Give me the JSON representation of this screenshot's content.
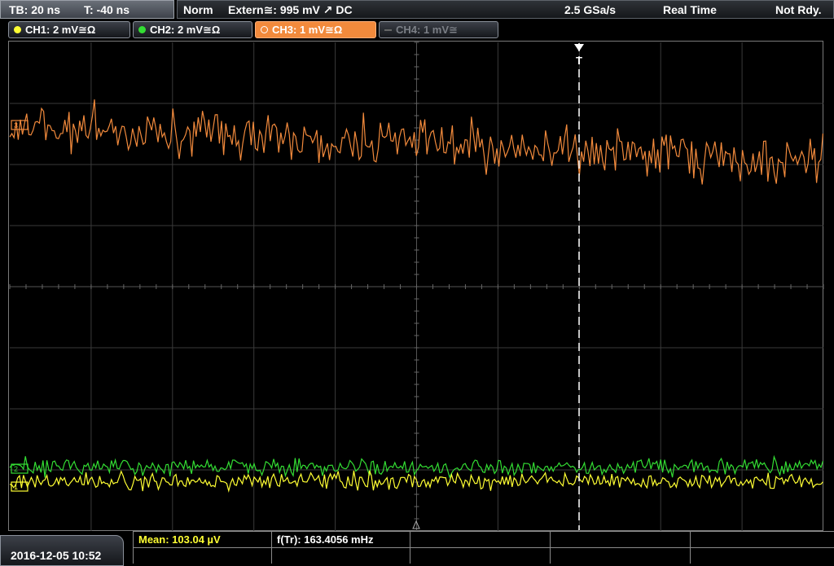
{
  "timebase": {
    "tb": "TB: 20 ns",
    "trigger_time": "T: -40 ns"
  },
  "status": {
    "mode": "Norm",
    "trigger_source": "Extern≅: 995 mV ↗ DC",
    "sample_rate": "2.5 GSa/s",
    "acq_mode": "Real Time",
    "state": "Not Rdy."
  },
  "channels": [
    {
      "label": "CH1: 2 mV≅Ω",
      "color": "#ffff33",
      "state": "on"
    },
    {
      "label": "CH2: 2 mV≅Ω",
      "color": "#33dd33",
      "state": "on"
    },
    {
      "label": "CH3: 1 mV≅Ω",
      "color": "#f28a3c",
      "state": "selected"
    },
    {
      "label": "CH4: 1 mV≅",
      "color": "#7b7f86",
      "state": "off"
    }
  ],
  "trigger_marker": "T",
  "measurements": {
    "mean": "Mean: 103.04 µV",
    "freq": "f(Tr): 163.4056 mHz"
  },
  "datetime": "2016-12-05 10:52",
  "icons": {
    "channel_dot": "circle-icon",
    "trigger_marker": "trigger-arrow-icon",
    "ground_marker": "ground-level-icon"
  }
}
